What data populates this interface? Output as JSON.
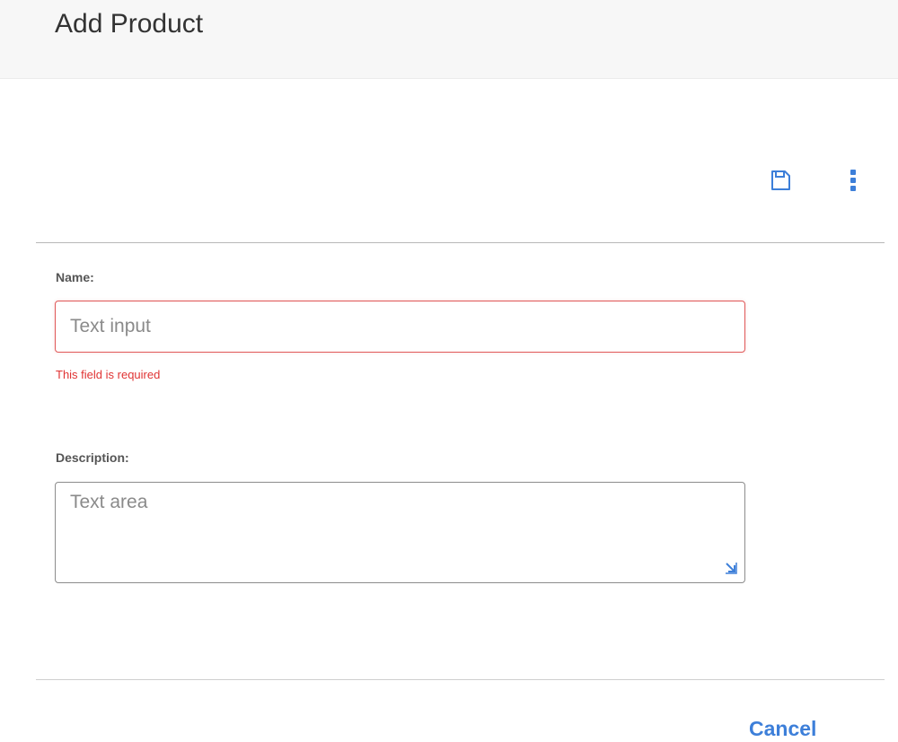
{
  "dialog": {
    "title": "Add Product"
  },
  "toolbar": {
    "save_icon": "save-icon",
    "more_icon": "more-vertical-icon",
    "icon_color": "#3d7fd9"
  },
  "form": {
    "name": {
      "label": "Name:",
      "value": "",
      "placeholder": "Text input",
      "error": "This field is required",
      "error_color": "#e03333"
    },
    "description": {
      "label": "Description:",
      "value": "",
      "placeholder": "Text area",
      "resize_icon": "resize-handle-icon"
    }
  },
  "footer": {
    "cancel_label": "Cancel",
    "accent_color": "#3d7fd9"
  }
}
